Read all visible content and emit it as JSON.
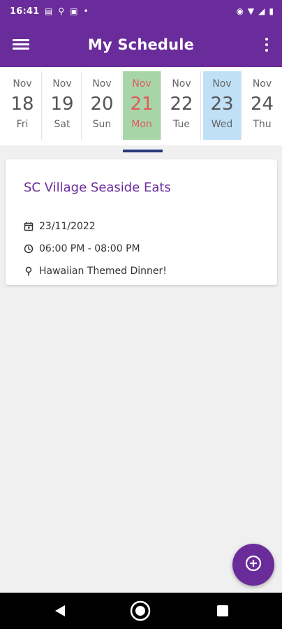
{
  "status_bar": {
    "time": "16:41"
  },
  "app_bar": {
    "title": "My Schedule"
  },
  "calendar": {
    "days": [
      {
        "month": "Nov",
        "day": "18",
        "weekday": "Fri"
      },
      {
        "month": "Nov",
        "day": "19",
        "weekday": "Sat"
      },
      {
        "month": "Nov",
        "day": "20",
        "weekday": "Sun"
      },
      {
        "month": "Nov",
        "day": "21",
        "weekday": "Mon"
      },
      {
        "month": "Nov",
        "day": "22",
        "weekday": "Tue"
      },
      {
        "month": "Nov",
        "day": "23",
        "weekday": "Wed"
      },
      {
        "month": "Nov",
        "day": "24",
        "weekday": "Thu"
      }
    ],
    "today_index": 3,
    "selected_index": 5
  },
  "event": {
    "title": "SC Village Seaside Eats",
    "date": "23/11/2022",
    "time": "06:00 PM - 08:00 PM",
    "description": "Hawaiian Themed Dinner!"
  },
  "colors": {
    "primary": "#6a2c9a",
    "today_bg": "#a8d5a8",
    "today_text": "#e05b5b",
    "selected_bg": "#bfe0f7",
    "indicator": "#263a7a"
  },
  "icons": {
    "menu": "hamburger-menu-icon",
    "more": "more-vert-icon",
    "calendar": "calendar-icon",
    "clock": "clock-icon",
    "location": "location-pin-icon",
    "add": "add-circle-icon"
  }
}
